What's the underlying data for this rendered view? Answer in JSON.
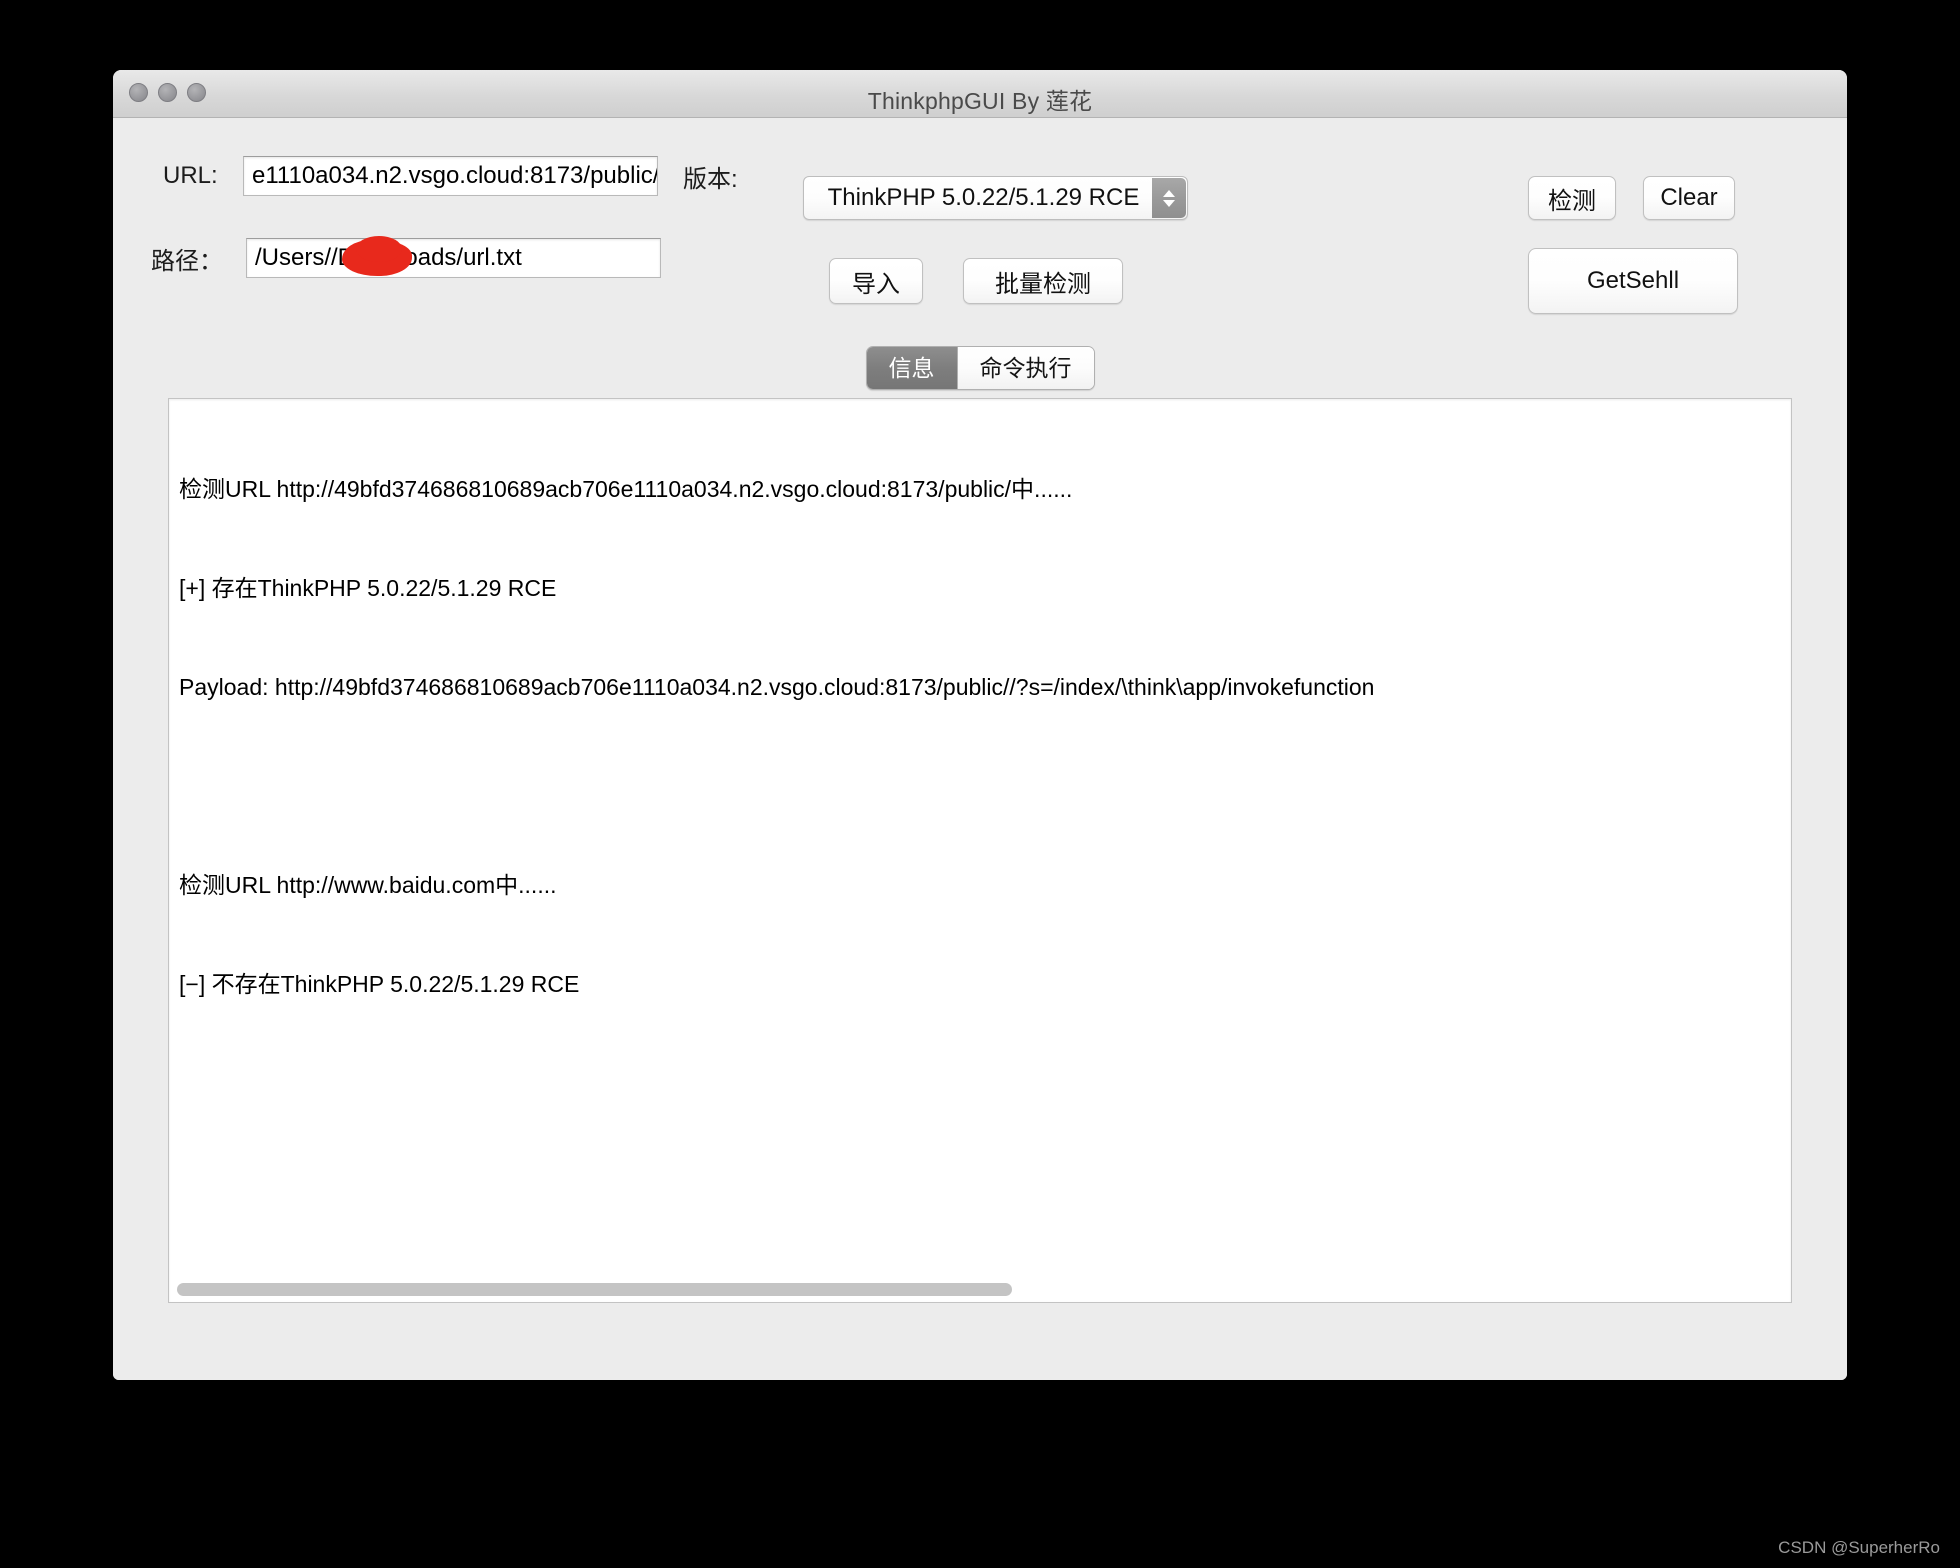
{
  "window": {
    "title": "ThinkphpGUI By 莲花",
    "traffic_lights": [
      "close",
      "minimize",
      "zoom"
    ]
  },
  "form": {
    "url_label": "URL:",
    "url_value": "e1110a034.n2.vsgo.cloud:8173/public/",
    "version_label": "版本:",
    "version_selected": "ThinkPHP 5.0.22/5.1.29 RCE",
    "detect_button": "检测",
    "clear_button": "Clear",
    "path_label": "路径：",
    "path_value_prefix": "/Users/",
    "path_value_suffix": "/Downloads/url.txt",
    "import_button": "导入",
    "batch_detect_button": "批量检测",
    "getshell_button": "GetSehll"
  },
  "tabs": [
    {
      "label": "信息",
      "selected": true
    },
    {
      "label": "命令执行",
      "selected": false
    }
  ],
  "log": {
    "lines": [
      "检测URL http://49bfd374686810689acb706e1110a034.n2.vsgo.cloud:8173/public/中......",
      "[+] 存在ThinkPHP 5.0.22/5.1.29 RCE",
      "Payload: http://49bfd374686810689acb706e1110a034.n2.vsgo.cloud:8173/public//?s=/index/\\think\\app/invokefunction",
      "",
      "检测URL http://www.baidu.com中......",
      "[−] 不存在ThinkPHP 5.0.22/5.1.29 RCE"
    ]
  },
  "watermark": "CSDN @SuperherRo"
}
